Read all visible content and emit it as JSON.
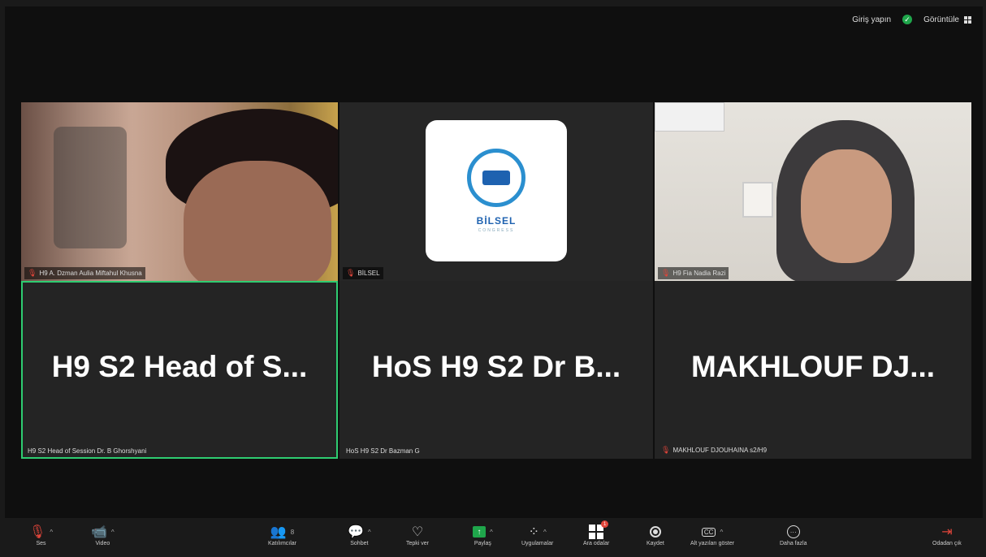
{
  "topbar": {
    "signin_label": "Giriş yapın",
    "view_label": "Görüntüle",
    "shield_icon": "shield-check-icon",
    "view_icon": "grid-icon"
  },
  "tiles": [
    {
      "video_name": "H9 A. Dzman Aulia Miftahul Khusna",
      "big_name": "H9 S2 Head of S...",
      "name_label": "H9 S2 Head of Session Dr. B Ghorshyani",
      "mic_muted": true,
      "active": true
    },
    {
      "video_name": "BİLSEL",
      "big_name": "HoS H9 S2 Dr B...",
      "name_label": "HoS H9 S2 Dr Bazman G",
      "mic_muted": false,
      "active": false,
      "logo": {
        "title": "BİLSEL",
        "subtitle": "CONGRESS"
      }
    },
    {
      "video_name": "H9 Fia Nadia Razi",
      "big_name": "MAKHLOUF  DJ...",
      "name_label": "MAKHLOUF DJOUHAINA s2/H9",
      "mic_muted": true,
      "active": false
    }
  ],
  "toolbar": {
    "audio": "Ses",
    "video": "Video",
    "participants": "Katılımcılar",
    "participants_count": "8",
    "chat": "Sohbet",
    "reactions": "Tepki ver",
    "share": "Paylaş",
    "apps": "Uygulamalar",
    "breakout": "Ara odalar",
    "breakout_badge": "1",
    "record": "Kaydet",
    "captions": "Alt yazıları göster",
    "more": "Daha fazla",
    "leave": "Odadan çık"
  },
  "colors": {
    "active_border": "#2ecc71",
    "muted": "#e0453a",
    "share": "#1fa64b"
  }
}
